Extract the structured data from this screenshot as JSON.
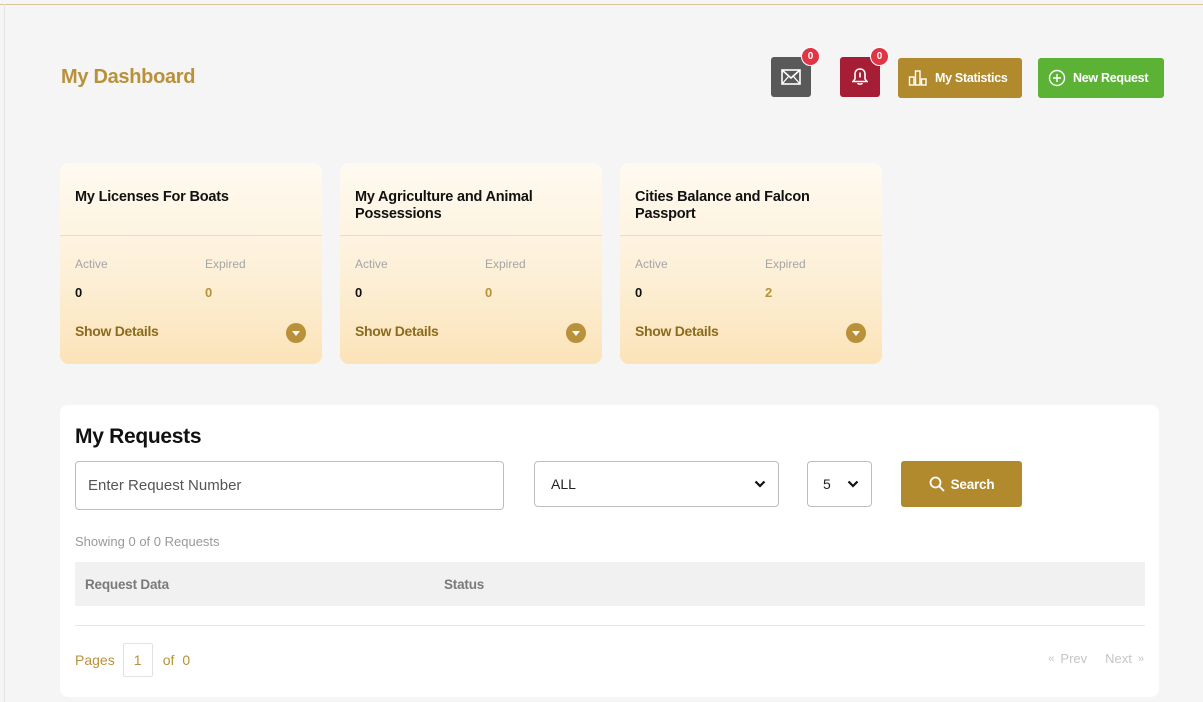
{
  "header": {
    "title": "My Dashboard",
    "mail": {
      "icon": "envelope-icon",
      "badge": "0"
    },
    "notifications": {
      "icon": "bell-icon",
      "badge": "0"
    },
    "statistics_label": "My Statistics",
    "new_request_label": "New Request"
  },
  "cards": [
    {
      "title": "My Licenses For Boats",
      "active_label": "Active",
      "expired_label": "Expired",
      "active": "0",
      "expired": "0",
      "details_label": "Show Details"
    },
    {
      "title": "My Agriculture and Animal Possessions",
      "active_label": "Active",
      "expired_label": "Expired",
      "active": "0",
      "expired": "0",
      "details_label": "Show Details"
    },
    {
      "title": "Cities Balance and Falcon Passport",
      "active_label": "Active",
      "expired_label": "Expired",
      "active": "0",
      "expired": "2",
      "details_label": "Show Details"
    }
  ],
  "requests": {
    "title": "My Requests",
    "search_placeholder": "Enter Request Number",
    "status_filter": "ALL",
    "page_size": "5",
    "search_label": "Search",
    "showing_text": "Showing 0 of 0 Requests",
    "columns": [
      "Request Data",
      "Status"
    ],
    "pagination": {
      "pages_label": "Pages",
      "current_page": "1",
      "of_label": "of",
      "total_pages": "0",
      "prev_label": "Prev",
      "next_label": "Next"
    }
  },
  "colors": {
    "gold": "#b8913a",
    "gold_button": "#b08a2c",
    "green": "#5cb234",
    "mail_bg": "#595959",
    "bell_bg": "#a51e36",
    "badge": "#e03545"
  }
}
